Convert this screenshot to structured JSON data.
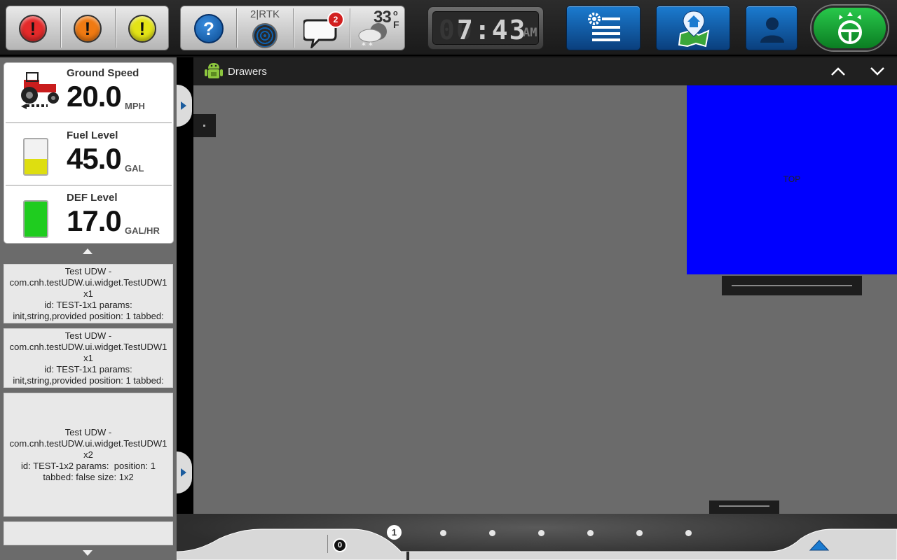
{
  "topbar": {
    "alerts": [
      {
        "severity": "critical",
        "symbol": "!",
        "color": "#e52a2a"
      },
      {
        "severity": "warning",
        "symbol": "!",
        "color": "#f07a12"
      },
      {
        "severity": "caution",
        "symbol": "!",
        "color": "#e3e316"
      }
    ],
    "help_symbol": "?",
    "gps": {
      "label": "2|RTK",
      "icon": "satellite-radar-icon"
    },
    "messages": {
      "icon": "chat-bubble-icon",
      "count": "2"
    },
    "weather": {
      "temperature": "33",
      "degree": "o",
      "unit": "F",
      "icon": "snow-cloud-icon"
    },
    "clock": {
      "ghost": "00",
      "time": "7:43",
      "ampm": "AM"
    },
    "buttons": [
      {
        "name": "settings-menu",
        "icon": "gear-list-icon"
      },
      {
        "name": "field-home",
        "icon": "home-map-icon"
      },
      {
        "name": "operator-profile",
        "icon": "person-icon"
      },
      {
        "name": "autoguidance-steering",
        "icon": "steering-wheel-icon",
        "color": "#16a636"
      }
    ]
  },
  "gauges": [
    {
      "label": "Ground Speed",
      "value": "20.0",
      "unit": "MPH",
      "icon": "tractor-icon"
    },
    {
      "label": "Fuel Level",
      "value": "45.0",
      "unit": "GAL",
      "icon": "fuel-tank-icon",
      "level": 0.45,
      "color": "#dede10"
    },
    {
      "label": "DEF Level",
      "value": "17.0",
      "unit": "GAL/HR",
      "icon": "def-tank-icon",
      "level": 1.0,
      "color": "#1fcc1f"
    }
  ],
  "udw_widgets": [
    {
      "lines": [
        "Test UDW -",
        "com.cnh.testUDW.ui.widget.TestUDW1",
        "x1",
        "id: TEST-1x1 params:",
        "init,string,provided position: 1 tabbed:"
      ]
    },
    {
      "lines": [
        "Test UDW -",
        "com.cnh.testUDW.ui.widget.TestUDW1",
        "x1",
        "id: TEST-1x1 params:",
        "init,string,provided position: 1 tabbed:"
      ]
    },
    {
      "lines": [
        "Test UDW -",
        "com.cnh.testUDW.ui.widget.TestUDW1",
        "x2",
        "id: TEST-1x2 params:  position: 1",
        "tabbed: false size: 1x2"
      ]
    }
  ],
  "window": {
    "title": "Drawers",
    "icon": "android-icon",
    "up_icon": "chevron-up-icon",
    "down_icon": "chevron-down-icon",
    "top_drawer_label": "TOP",
    "top_drawer_color": "#0000ff"
  },
  "bottombar": {
    "count_badge": "0",
    "current_page": "1",
    "page_count": 7
  }
}
